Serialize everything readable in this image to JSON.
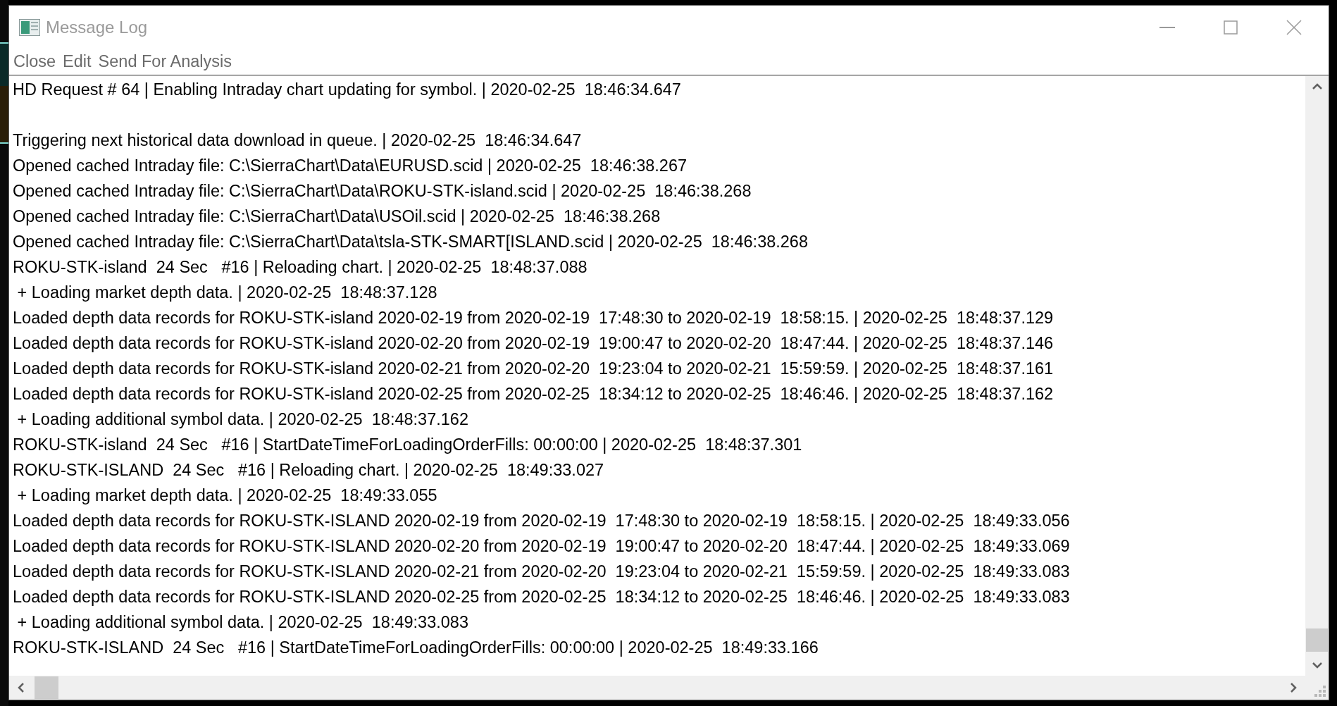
{
  "window": {
    "title": "Message Log"
  },
  "menu": [
    "Close",
    "Edit",
    "Send For Analysis"
  ],
  "lines": [
    {
      "text": "HD Request # 64 | Enabling Intraday chart updating for symbol. | 2020-02-25  18:46:34.647",
      "gap_after": true
    },
    {
      "text": "Triggering next historical data download in queue. | 2020-02-25  18:46:34.647",
      "gap_after": false
    },
    {
      "text": "Opened cached Intraday file: C:\\SierraChart\\Data\\EURUSD.scid | 2020-02-25  18:46:38.267",
      "gap_after": false
    },
    {
      "text": "Opened cached Intraday file: C:\\SierraChart\\Data\\ROKU-STK-island.scid | 2020-02-25  18:46:38.268",
      "gap_after": false
    },
    {
      "text": "Opened cached Intraday file: C:\\SierraChart\\Data\\USOil.scid | 2020-02-25  18:46:38.268",
      "gap_after": false
    },
    {
      "text": "Opened cached Intraday file: C:\\SierraChart\\Data\\tsla-STK-SMART[ISLAND.scid | 2020-02-25  18:46:38.268",
      "gap_after": false
    },
    {
      "text": "ROKU-STK-island  24 Sec   #16 | Reloading chart. | 2020-02-25  18:48:37.088",
      "gap_after": false
    },
    {
      "text": " + Loading market depth data. | 2020-02-25  18:48:37.128",
      "gap_after": false
    },
    {
      "text": "Loaded depth data records for ROKU-STK-island 2020-02-19 from 2020-02-19  17:48:30 to 2020-02-19  18:58:15. | 2020-02-25  18:48:37.129",
      "gap_after": false
    },
    {
      "text": "Loaded depth data records for ROKU-STK-island 2020-02-20 from 2020-02-19  19:00:47 to 2020-02-20  18:47:44. | 2020-02-25  18:48:37.146",
      "gap_after": false
    },
    {
      "text": "Loaded depth data records for ROKU-STK-island 2020-02-21 from 2020-02-20  19:23:04 to 2020-02-21  15:59:59. | 2020-02-25  18:48:37.161",
      "gap_after": false
    },
    {
      "text": "Loaded depth data records for ROKU-STK-island 2020-02-25 from 2020-02-25  18:34:12 to 2020-02-25  18:46:46. | 2020-02-25  18:48:37.162",
      "gap_after": false
    },
    {
      "text": " + Loading additional symbol data. | 2020-02-25  18:48:37.162",
      "gap_after": false
    },
    {
      "text": "ROKU-STK-island  24 Sec   #16 | StartDateTimeForLoadingOrderFills: 00:00:00 | 2020-02-25  18:48:37.301",
      "gap_after": false
    },
    {
      "text": "ROKU-STK-ISLAND  24 Sec   #16 | Reloading chart. | 2020-02-25  18:49:33.027",
      "gap_after": false
    },
    {
      "text": " + Loading market depth data. | 2020-02-25  18:49:33.055",
      "gap_after": false
    },
    {
      "text": "Loaded depth data records for ROKU-STK-ISLAND 2020-02-19 from 2020-02-19  17:48:30 to 2020-02-19  18:58:15. | 2020-02-25  18:49:33.056",
      "gap_after": false
    },
    {
      "text": "Loaded depth data records for ROKU-STK-ISLAND 2020-02-20 from 2020-02-19  19:00:47 to 2020-02-20  18:47:44. | 2020-02-25  18:49:33.069",
      "gap_after": false
    },
    {
      "text": "Loaded depth data records for ROKU-STK-ISLAND 2020-02-21 from 2020-02-20  19:23:04 to 2020-02-21  15:59:59. | 2020-02-25  18:49:33.083",
      "gap_after": false
    },
    {
      "text": "Loaded depth data records for ROKU-STK-ISLAND 2020-02-25 from 2020-02-25  18:34:12 to 2020-02-25  18:46:46. | 2020-02-25  18:49:33.083",
      "gap_after": false
    },
    {
      "text": " + Loading additional symbol data. | 2020-02-25  18:49:33.083",
      "gap_after": false
    },
    {
      "text": "ROKU-STK-ISLAND  24 Sec   #16 | StartDateTimeForLoadingOrderFills: 00:00:00 | 2020-02-25  18:49:33.166",
      "gap_after": false
    }
  ]
}
